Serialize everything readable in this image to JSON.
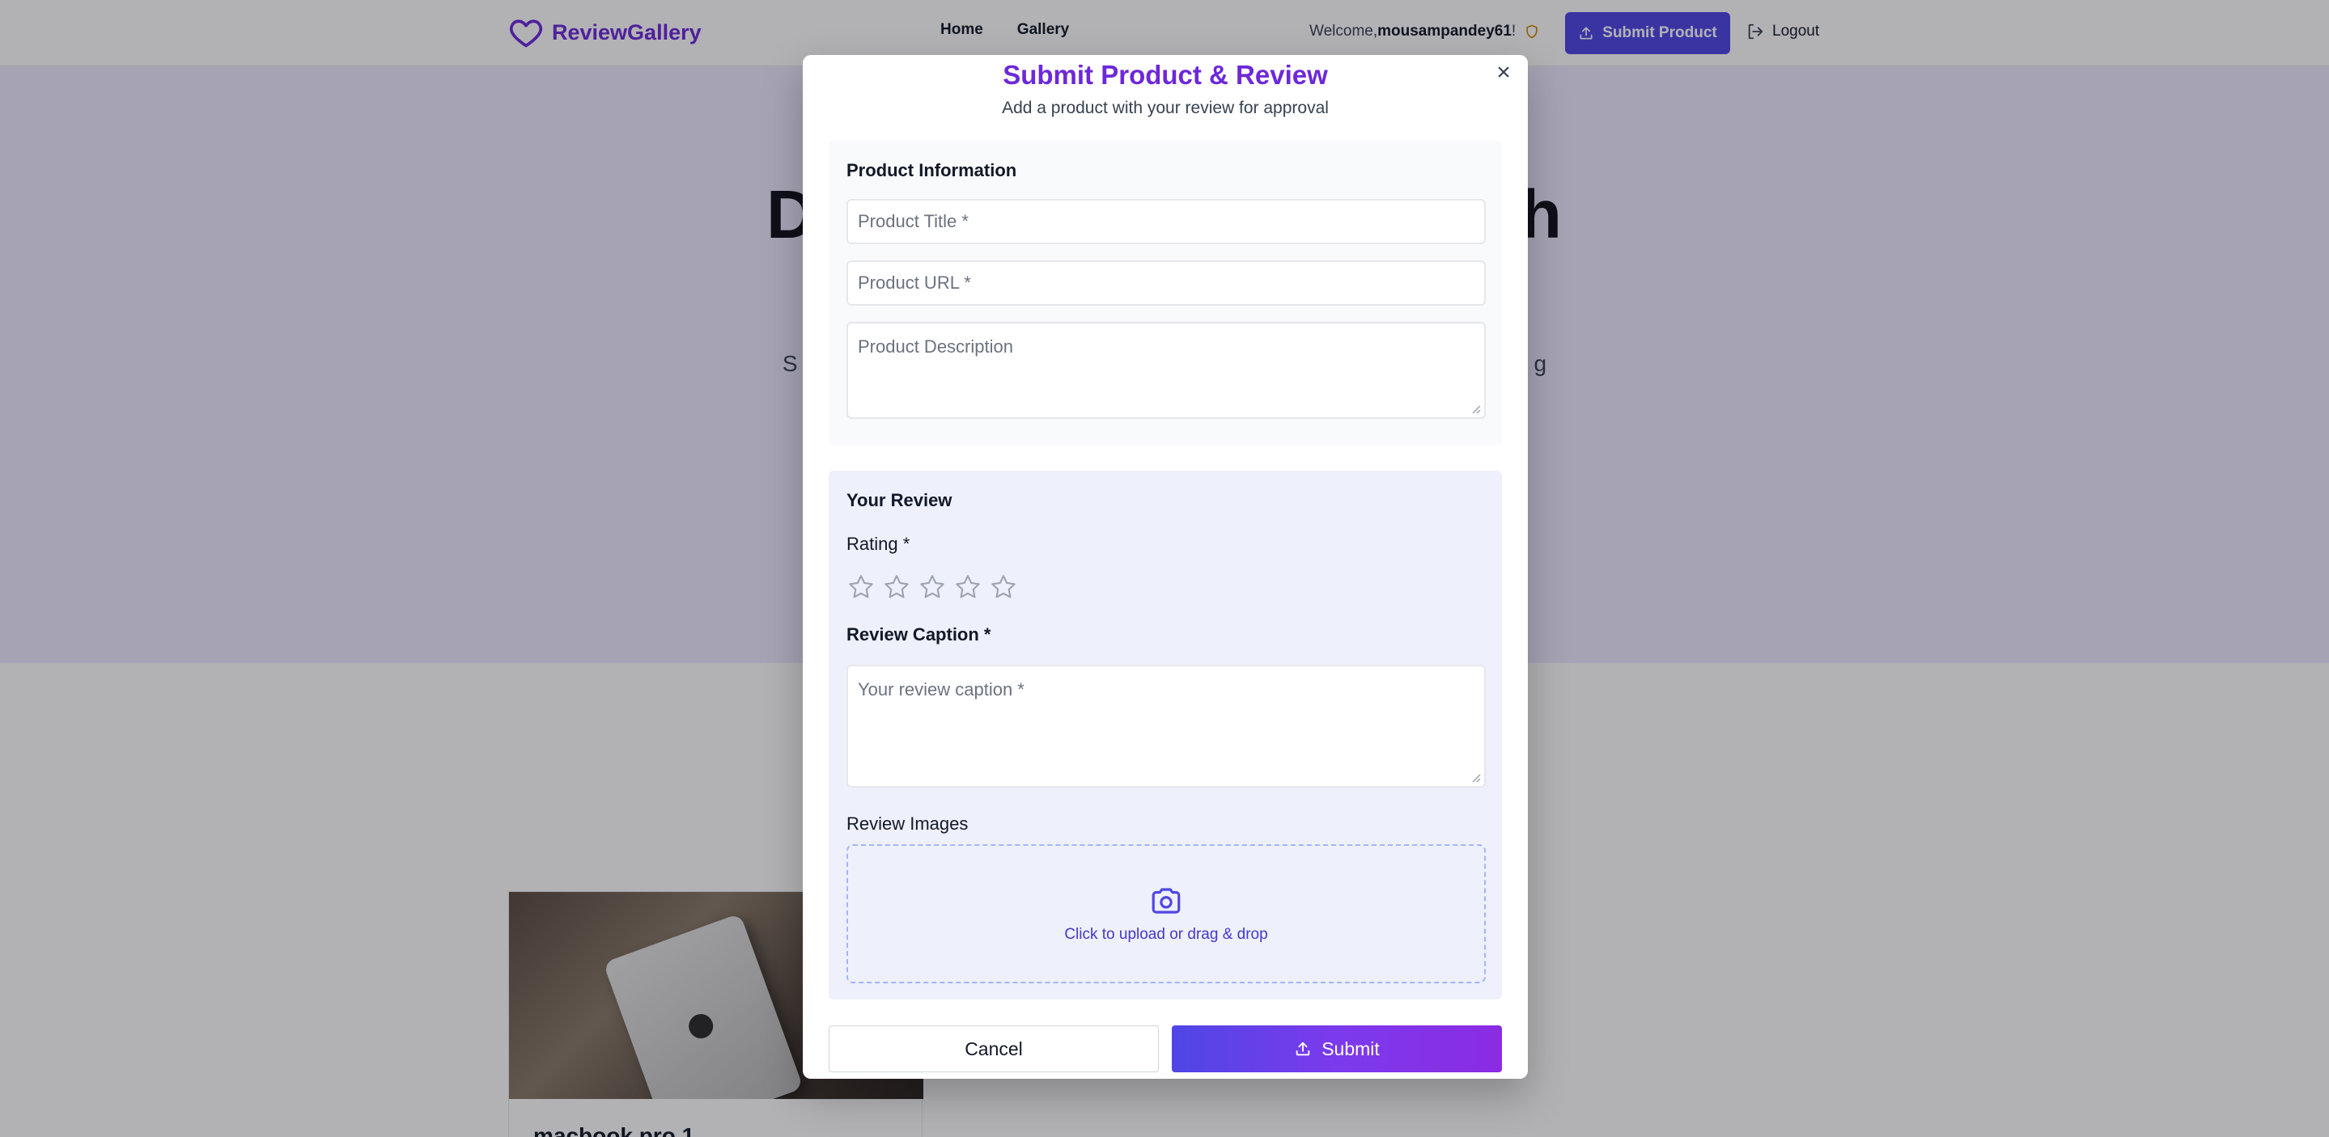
{
  "navbar": {
    "brand": "ReviewGallery",
    "links": [
      "Home",
      "Gallery"
    ],
    "welcome_prefix": "Welcome, ",
    "username": "mousampandey61",
    "welcome_suffix": "!",
    "submit_product_label": "Submit Product",
    "logout_label": "Logout"
  },
  "hero": {
    "title_visible_left": "D",
    "title_visible_right": "h",
    "subtitle_visible_left": "S",
    "subtitle_visible_right": "g"
  },
  "card": {
    "title_partial": "macbook pro 1"
  },
  "modal": {
    "title": "Submit Product & Review",
    "subtitle": "Add a product with your review for approval",
    "close_symbol": "×",
    "product_section": {
      "heading": "Product Information",
      "title_placeholder": "Product Title *",
      "url_placeholder": "Product URL *",
      "description_placeholder": "Product Description"
    },
    "review_section": {
      "heading": "Your Review",
      "rating_label": "Rating *",
      "rating_value": 0,
      "rating_max": 5,
      "caption_label": "Review Caption *",
      "caption_placeholder": "Your review caption *",
      "images_label": "Review Images",
      "upload_text": "Click to upload or drag & drop"
    },
    "cancel_label": "Cancel",
    "submit_label": "Submit"
  },
  "colors": {
    "brand": "#6d28d9",
    "primary": "#4f46e5",
    "hero_bg": "#ede9fe",
    "review_bg": "#eef0fb"
  },
  "icons": {
    "brand": "heart-icon",
    "shield": "shield-icon",
    "upload": "upload-icon",
    "logout": "logout-icon",
    "close": "close-icon",
    "star": "star-outline-icon",
    "camera": "camera-icon"
  }
}
